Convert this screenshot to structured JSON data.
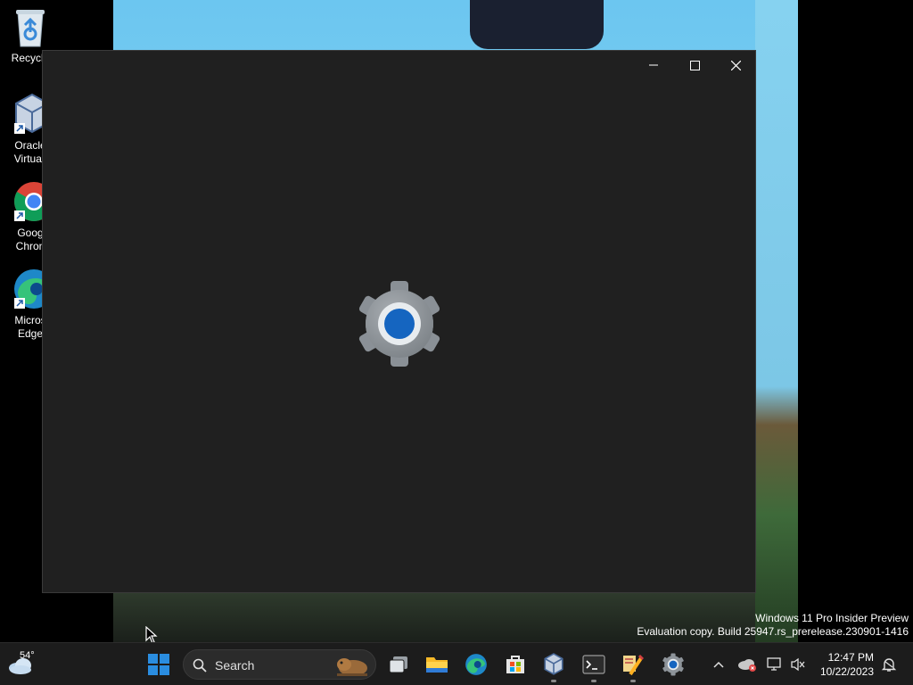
{
  "desktop": {
    "icons": [
      {
        "label_line1": "Recycle",
        "label_line2": "",
        "icon": "recycle-bin-icon"
      },
      {
        "label_line1": "Oracle",
        "label_line2": "Virtuall",
        "icon": "virtualbox-icon"
      },
      {
        "label_line1": "Goog",
        "label_line2": "Chron",
        "icon": "chrome-icon"
      },
      {
        "label_line1": "Micros",
        "label_line2": "Edge",
        "icon": "edge-icon"
      }
    ]
  },
  "window": {
    "splash_icon": "settings-gear-icon",
    "controls": [
      "minimize-icon",
      "maximize-icon",
      "close-icon"
    ]
  },
  "watermark": {
    "line1": "Windows 11 Pro Insider Preview",
    "line2": "Evaluation copy. Build 25947.rs_prerelease.230901-1416"
  },
  "taskbar": {
    "weather_temp": "54°",
    "search_placeholder": "Search",
    "pinned": [
      "start-icon",
      "task-view-icon",
      "file-explorer-icon",
      "edge-icon",
      "store-icon",
      "virtualbox-icon",
      "terminal-icon",
      "tools-icon",
      "settings-icon"
    ],
    "clock_time": "12:47 PM",
    "clock_date": "10/22/2023"
  },
  "colors": {
    "accent_blue": "#1565c0",
    "taskbar_bg": "#1c1c1c",
    "window_bg": "#202020"
  }
}
